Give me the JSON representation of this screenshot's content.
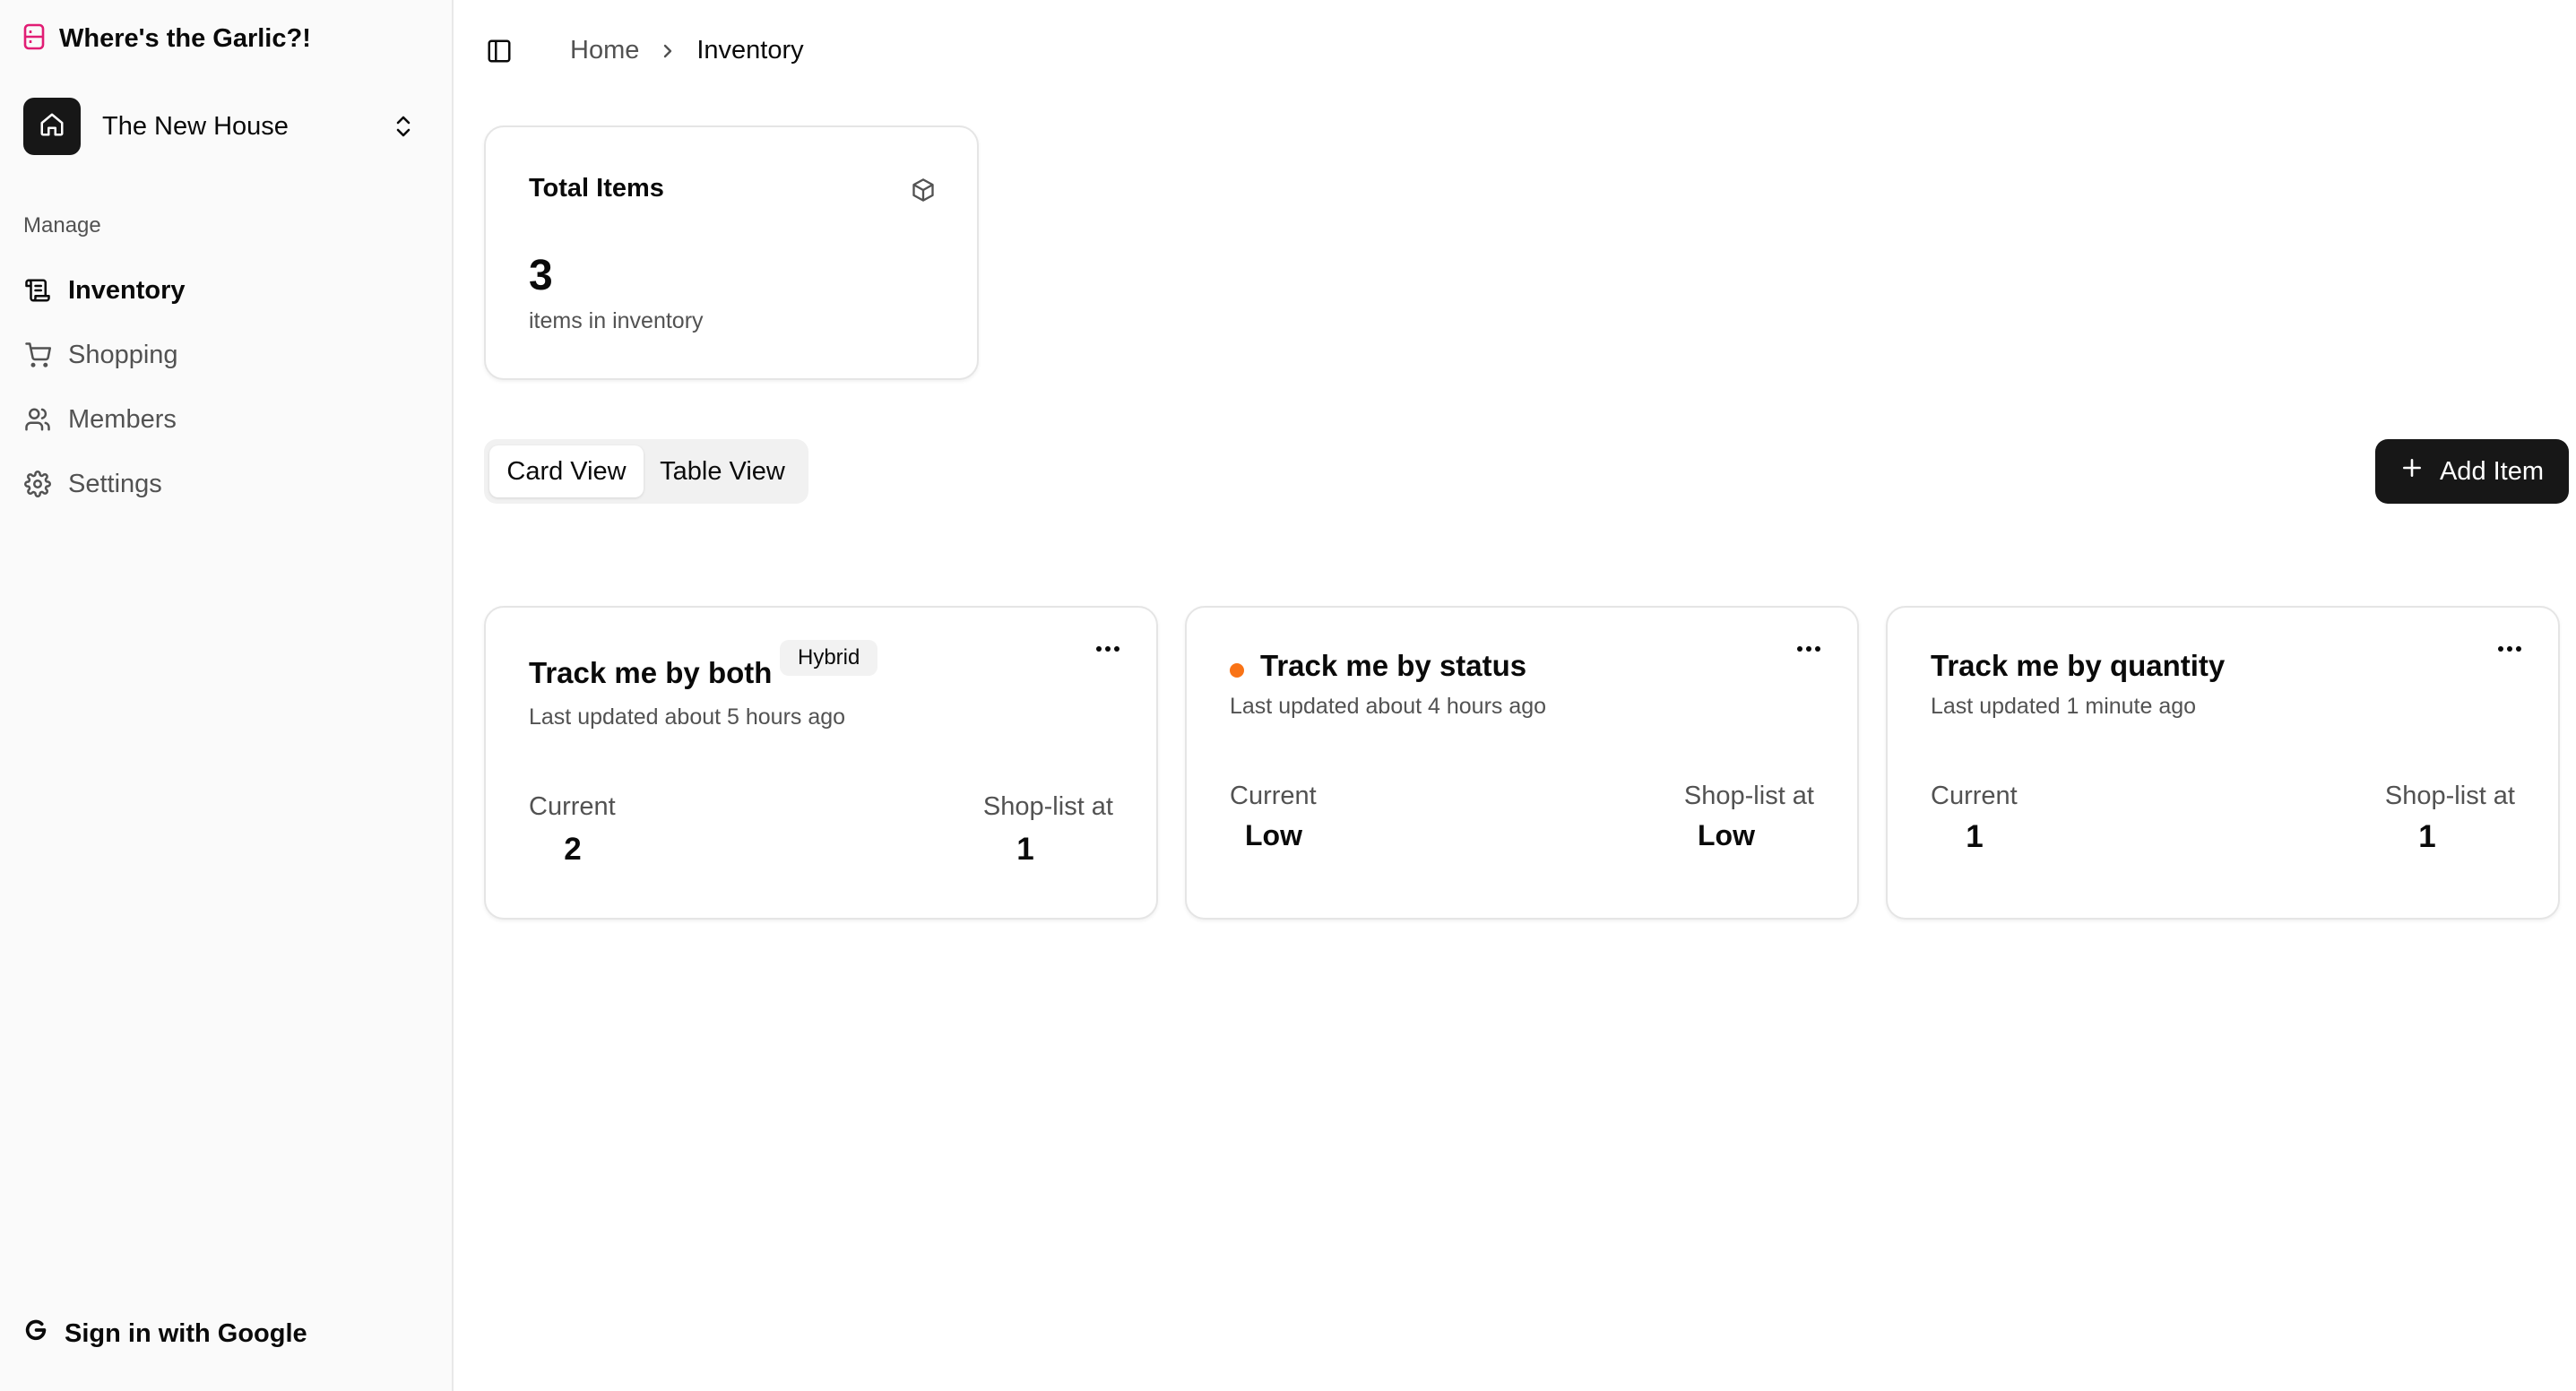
{
  "app": {
    "name": "Where's the Garlic?!"
  },
  "house": {
    "name": "The New House"
  },
  "sidebar": {
    "group_label": "Manage",
    "items": [
      {
        "label": "Inventory",
        "icon": "scroll-icon",
        "active": true
      },
      {
        "label": "Shopping",
        "icon": "cart-icon",
        "active": false
      },
      {
        "label": "Members",
        "icon": "users-icon",
        "active": false
      },
      {
        "label": "Settings",
        "icon": "gear-icon",
        "active": false
      }
    ],
    "sign_in": "Sign in with Google"
  },
  "breadcrumb": {
    "home": "Home",
    "current": "Inventory"
  },
  "stats": {
    "title": "Total Items",
    "value": "3",
    "subtitle": "items in inventory",
    "icon": "package-icon"
  },
  "view_tabs": {
    "card": "Card View",
    "table": "Table View",
    "selected": "Card View"
  },
  "add_button": {
    "label": "Add Item",
    "icon": "plus-icon"
  },
  "items": [
    {
      "title": "Track me by both",
      "badge": "Hybrid",
      "updated": "Last updated about 5 hours ago",
      "current_label": "Current",
      "current": "2",
      "threshold_label": "Shop-list at",
      "threshold": "1"
    },
    {
      "title": "Track me by status",
      "status_color": "#f97316",
      "updated": "Last updated about 4 hours ago",
      "current_label": "Current",
      "current": "Low",
      "threshold_label": "Shop-list at",
      "threshold": "Low"
    },
    {
      "title": "Track me by quantity",
      "updated": "Last updated 1 minute ago",
      "current_label": "Current",
      "current": "1",
      "threshold_label": "Shop-list at",
      "threshold": "1"
    }
  ],
  "colors": {
    "accent": "#e11d74",
    "primary_button": "#171717",
    "status_low": "#f97316"
  }
}
